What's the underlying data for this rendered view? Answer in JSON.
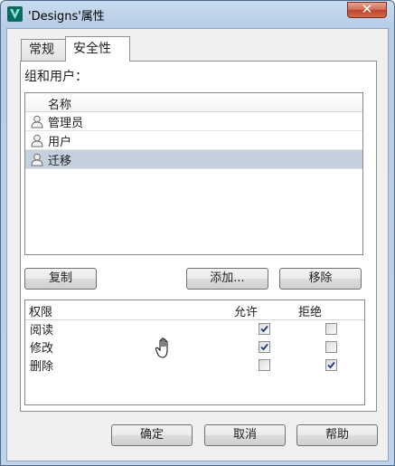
{
  "window": {
    "title": "'Designs'属性",
    "close_label": "✕"
  },
  "tabs": [
    {
      "label": "常规"
    },
    {
      "label": "安全性"
    }
  ],
  "groups": {
    "label": "组和用户：",
    "column_header": "名称",
    "users": [
      {
        "name": "管理员",
        "selected": false
      },
      {
        "name": "用户",
        "selected": false
      },
      {
        "name": "迁移",
        "selected": true
      }
    ]
  },
  "buttons": {
    "copy": "复制",
    "add": "添加...",
    "remove": "移除"
  },
  "permissions": {
    "header_name": "权限",
    "header_allow": "允许",
    "header_deny": "拒绝",
    "rows": [
      {
        "name": "阅读",
        "allow": true,
        "deny": false
      },
      {
        "name": "修改",
        "allow": true,
        "deny": false
      },
      {
        "name": "删除",
        "allow": false,
        "deny": true
      }
    ]
  },
  "footer": {
    "ok": "确定",
    "cancel": "取消",
    "help": "帮助"
  }
}
